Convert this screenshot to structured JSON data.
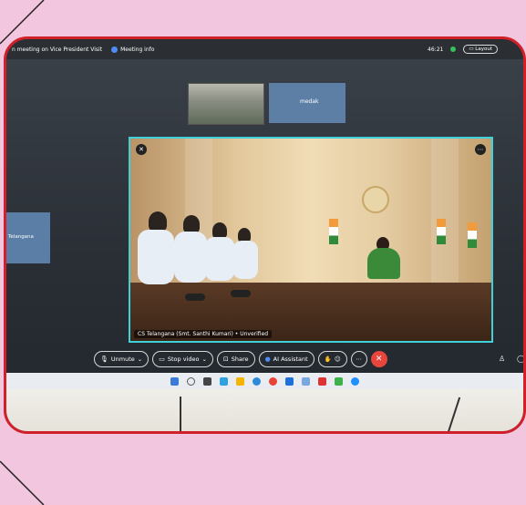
{
  "meeting": {
    "title": "n meeting on Vice President Visit",
    "info_label": "Meeting info",
    "timer": "46:21",
    "layout_label": "Layout"
  },
  "thumbnails": {
    "second_label": "medak"
  },
  "side_tile": {
    "label": "Telangana"
  },
  "main_video": {
    "caption": "CS Telangana (Smt. Santhi Kumari) • Unverified"
  },
  "controls": {
    "unmute": "Unmute",
    "stop_video": "Stop video",
    "share": "Share",
    "ai_assistant": "AI Assistant"
  },
  "colors": {
    "frame": "#d0202a",
    "active_speaker_border": "#3fd0d9",
    "end_call": "#e8453c"
  }
}
